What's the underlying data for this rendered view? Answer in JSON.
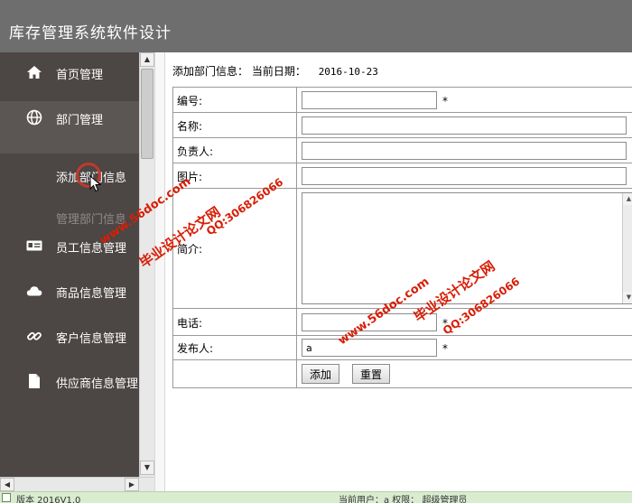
{
  "app": {
    "title": "库存管理系统软件设计"
  },
  "sidebar": {
    "items": [
      {
        "label": "首页管理",
        "icon": "home-icon"
      },
      {
        "label": "部门管理",
        "icon": "globe-icon"
      },
      {
        "label": "员工信息管理",
        "icon": "id-card-icon"
      },
      {
        "label": "商品信息管理",
        "icon": "cloud-icon"
      },
      {
        "label": "客户信息管理",
        "icon": "link-icon"
      },
      {
        "label": "供应商信息管理",
        "icon": "file-icon"
      }
    ],
    "subitems": [
      {
        "label": "添加部门信息"
      },
      {
        "label": "管理部门信息"
      }
    ]
  },
  "main": {
    "heading": "添加部门信息：",
    "date_label": "当前日期：",
    "date_value": "2016-10-23"
  },
  "form": {
    "code_label": "编号:",
    "name_label": "名称:",
    "manager_label": "负责人:",
    "image_label": "图片:",
    "intro_label": "简介:",
    "phone_label": "电话:",
    "publisher_label": "发布人:",
    "publisher_value": "a",
    "required_mark": "*",
    "add_button": "添加",
    "reset_button": "重置"
  },
  "status": {
    "version": "版本 2016V1.0",
    "user": "当前用户：a 权限： 超级管理员"
  },
  "watermarks": {
    "site": "www.56doc.com",
    "qq": "QQ:306826066",
    "brand": "毕业设计论文网"
  },
  "colors": {
    "header_bg": "#6e6e6e",
    "sidebar_bg": "#4c4644",
    "watermark": "#d81e06",
    "statusbar_bg": "#d9ecd0"
  }
}
